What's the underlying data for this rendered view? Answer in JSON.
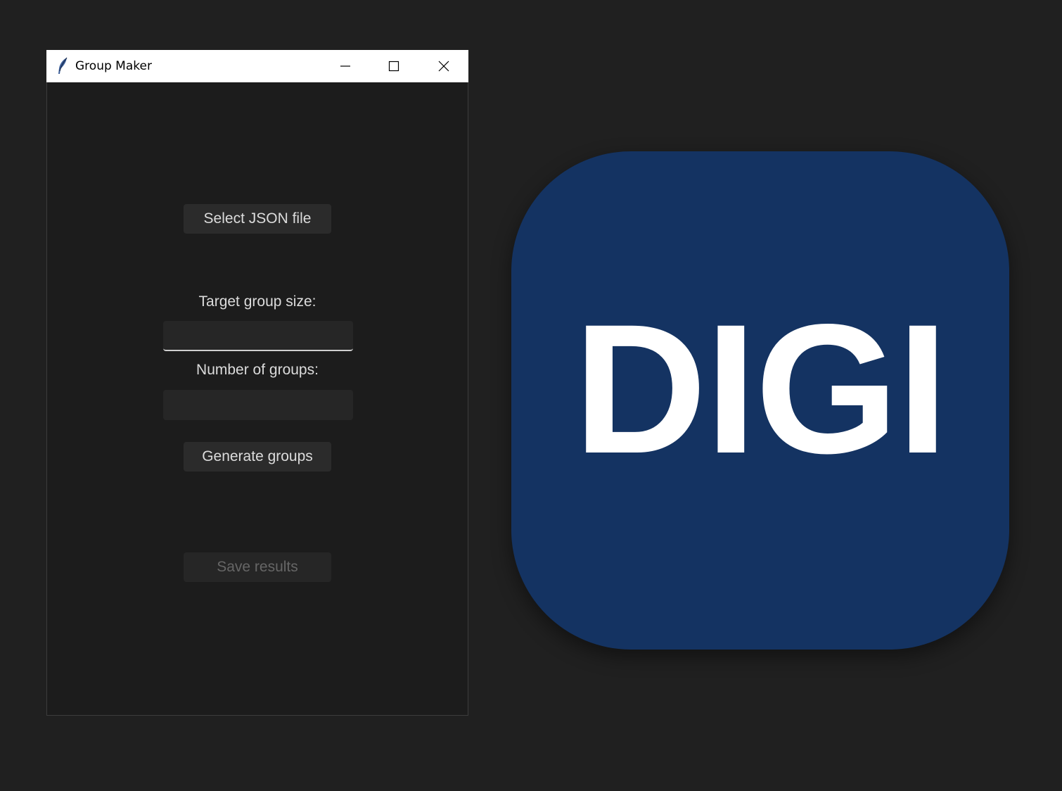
{
  "window": {
    "title": "Group Maker",
    "controls": {
      "minimize_icon": "minimize-icon",
      "maximize_icon": "maximize-icon",
      "close_icon": "close-icon"
    }
  },
  "main": {
    "select_file_button": "Select JSON file",
    "target_size_label": "Target group size:",
    "target_size_value": "",
    "num_groups_label": "Number of groups:",
    "num_groups_value": "",
    "generate_button": "Generate groups",
    "save_button": "Save results"
  },
  "logo": {
    "text": "DIGI",
    "background_color": "#143362",
    "text_color": "#ffffff"
  }
}
